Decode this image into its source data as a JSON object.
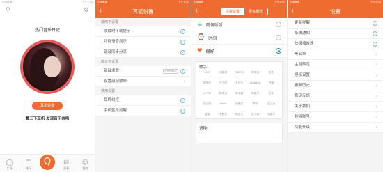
{
  "colors": {
    "accent": "#ef6c31",
    "check": "#2b8fc6"
  },
  "status": {
    "carrier": "中国联通",
    "battery": "67%",
    "time_1": "下午1:20",
    "time_2": "下午1:31",
    "time_3": "下午1:32",
    "time_4": "下午1:32"
  },
  "home": {
    "playlist_name": "热门音乐日记",
    "earphone_button": "耳机设置",
    "hint": "戴三下耳机  发现音乐共鸣",
    "tabs": [
      {
        "label": "广场",
        "icon": "square-icon"
      },
      {
        "label": "排行",
        "icon": "rank-icon"
      },
      {
        "label": "",
        "icon": "q-icon"
      },
      {
        "label": "消息",
        "icon": "message-icon"
      },
      {
        "label": "我的",
        "icon": "profile-icon"
      }
    ]
  },
  "earphone": {
    "title": "耳机设置",
    "sections": [
      {
        "title": "敲两下设置",
        "items": [
          {
            "label": "收藏时下载提示",
            "control": "check"
          },
          {
            "label": "功能语音提示",
            "control": "check"
          },
          {
            "label": "敲敲同步分享",
            "control": "check"
          }
        ]
      },
      {
        "title": "敲三下设置",
        "items": [
          {
            "label": "敲敲求歌",
            "tag": "仅WiFi模式",
            "control": "check"
          },
          {
            "label": "设置敲敲歌单",
            "control": "chevron"
          }
        ]
      },
      {
        "title": "通用设置",
        "items": [
          {
            "label": "耳机线控",
            "control": "check"
          },
          {
            "label": "手机蓝牙提醒",
            "control": "check"
          }
        ]
      }
    ]
  },
  "prefs": {
    "tab_on": "寻歌设置",
    "tab_off": "更多筛选",
    "options": [
      {
        "label": "随便听听",
        "icon": "cup-icon",
        "selected": false
      },
      {
        "label": "时间",
        "icon": "watch-icon",
        "selected": false
      },
      {
        "label": "偏好",
        "icon": "heart-icon",
        "selected": true
      }
    ],
    "singer_label": "歌手:",
    "singers": [
      "EXO",
      "邓紫棋",
      "TFBOYS",
      "李荣浩",
      "张杰",
      "周杰伦",
      "王力宏",
      "五月天",
      "bigbang",
      "许嵩",
      "卢广仲",
      "陈奕迅",
      "李宇春",
      "林俊杰",
      "王菲",
      "庄心妍",
      "Adele",
      "孙燕姿",
      "李宇",
      "王心凌",
      "戚薇",
      "苏慧伦",
      "吴亦凡",
      "张子豪",
      "刘德华"
    ],
    "language_label": "语种:"
  },
  "settings": {
    "title": "设置",
    "items": [
      {
        "label": "更新提醒",
        "control": "check"
      },
      {
        "label": "系统通知",
        "control": "check"
      },
      {
        "label": "快捷播放器",
        "control": "check"
      },
      {
        "label": "黑名单",
        "control": "chevron"
      },
      {
        "label": "主题颜定",
        "control": "chevron"
      },
      {
        "label": "授权设置",
        "control": "chevron"
      },
      {
        "label": "更新历史",
        "control": "chevron"
      },
      {
        "label": "意见反馈",
        "control": "chevron"
      },
      {
        "label": "关于我们",
        "control": "chevron"
      },
      {
        "label": "移除账号",
        "control": "chevron"
      },
      {
        "label": "功能升级",
        "control": "chevron"
      }
    ]
  }
}
